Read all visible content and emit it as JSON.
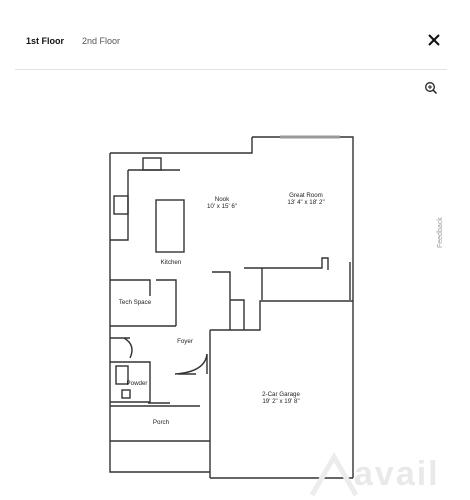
{
  "tabs": [
    {
      "label": "1st Floor",
      "active": true
    },
    {
      "label": "2nd Floor",
      "active": false
    }
  ],
  "icons": {
    "close": "close-icon",
    "zoom": "zoom-in-icon"
  },
  "feedback_label": "Feedback",
  "floorplan": {
    "rooms": [
      {
        "name": "Nook",
        "size": "10' x 15' 6\""
      },
      {
        "name": "Great Room",
        "size": "13' 4\" x 18' 2\""
      },
      {
        "name": "Kitchen",
        "size": ""
      },
      {
        "name": "Tech Space",
        "size": ""
      },
      {
        "name": "Foyer",
        "size": ""
      },
      {
        "name": "Powder",
        "size": ""
      },
      {
        "name": "2-Car Garage",
        "size": "19' 2\" x 19' 8\""
      },
      {
        "name": "Porch",
        "size": ""
      }
    ]
  },
  "watermark": "avail"
}
